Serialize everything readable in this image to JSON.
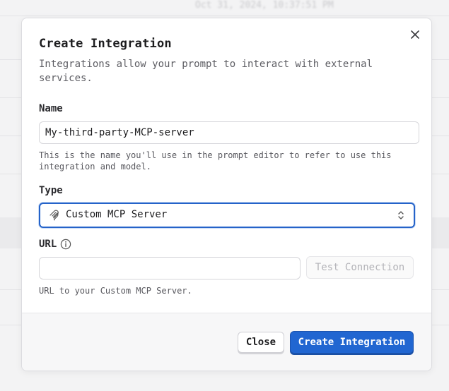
{
  "background": {
    "timestamp": "Oct 31, 2024, 10:37:51 PM"
  },
  "modal": {
    "title": "Create Integration",
    "description": "Integrations allow your prompt to interact with external services."
  },
  "name_field": {
    "label": "Name",
    "value": "My-third-party-MCP-server",
    "help": "This is the name you'll use in the prompt editor to refer to use this integration and model."
  },
  "type_field": {
    "label": "Type",
    "selected": "Custom MCP Server",
    "icon": "mcp-icon"
  },
  "url_field": {
    "label": "URL",
    "value": "",
    "placeholder": "",
    "help": "URL to your Custom MCP Server.",
    "test_button": "Test Connection"
  },
  "footer": {
    "close_label": "Close",
    "create_label": "Create Integration"
  },
  "colors": {
    "accent": "#2166d1",
    "focus_ring": "#2563c9"
  }
}
